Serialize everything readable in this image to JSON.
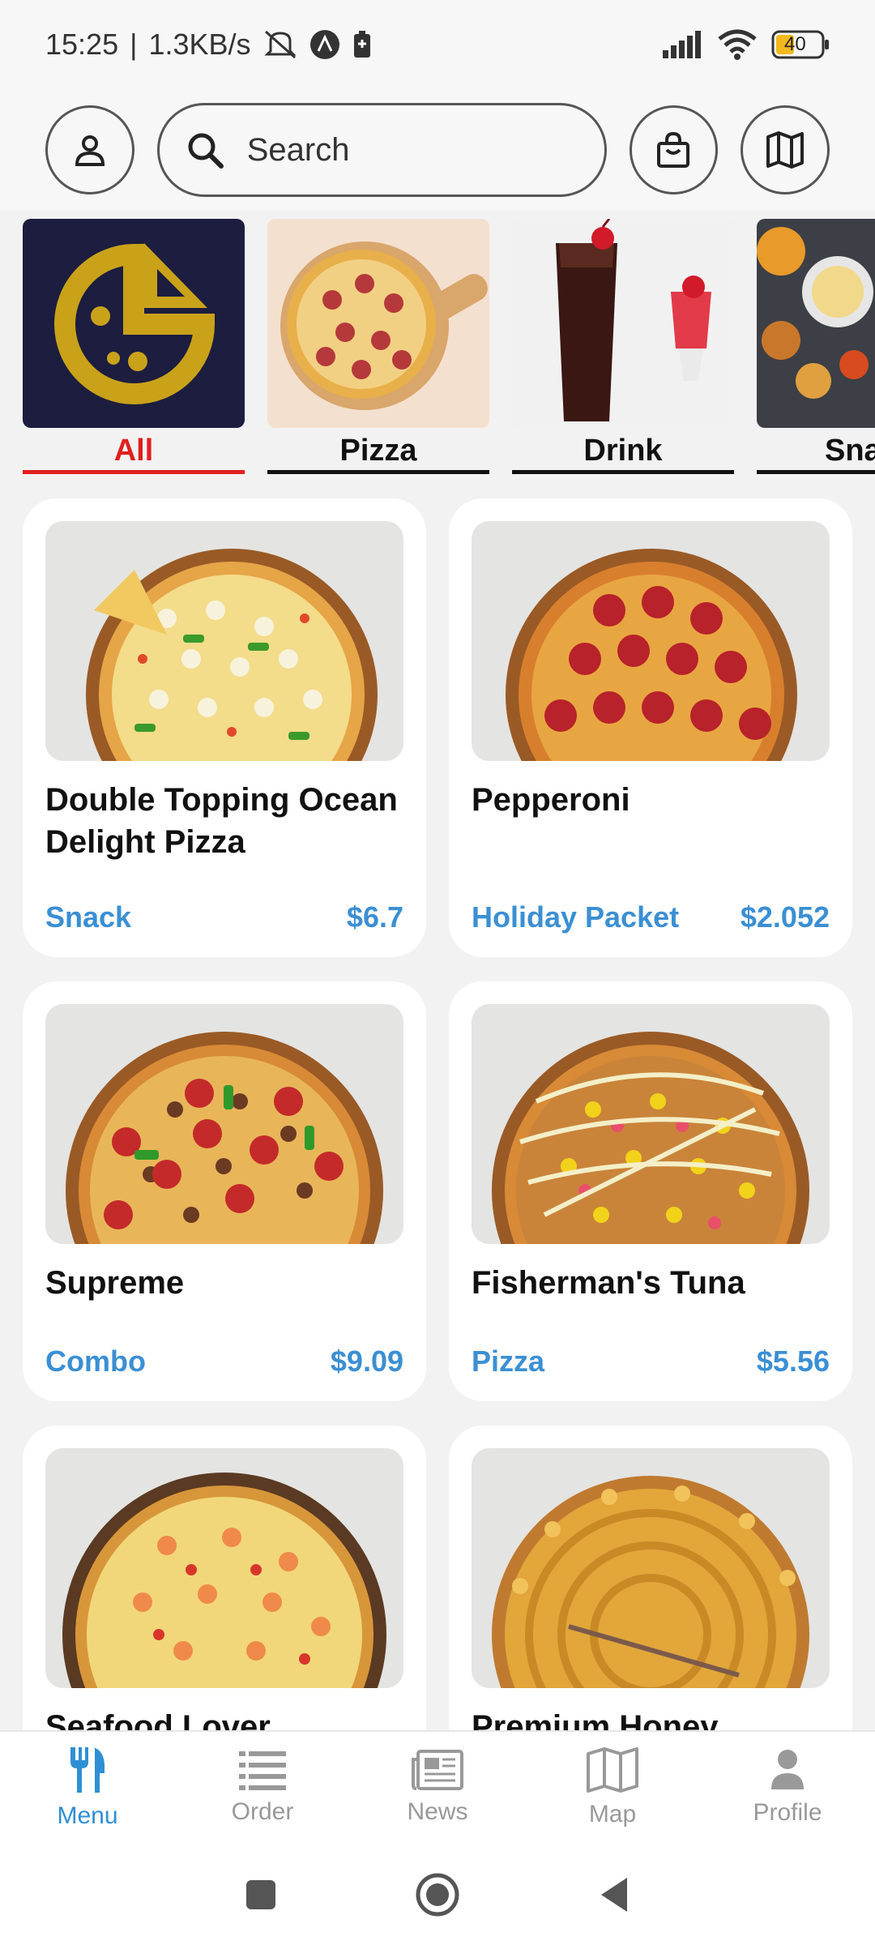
{
  "status_bar": {
    "time": "15:25",
    "network_speed": "1.3KB/s",
    "battery": "40",
    "icons": [
      "mute-icon",
      "app-a-icon",
      "battery-saver-icon",
      "signal-icon",
      "wifi-icon",
      "battery-icon"
    ]
  },
  "header": {
    "search_placeholder": "Search",
    "icons": [
      "user-icon",
      "search-icon",
      "shopping-bag-icon",
      "map-icon"
    ]
  },
  "categories": [
    {
      "label": "All",
      "active": true
    },
    {
      "label": "Pizza",
      "active": false
    },
    {
      "label": "Drink",
      "active": false
    },
    {
      "label": "Sna",
      "active": false
    }
  ],
  "products": [
    {
      "name": "Double Topping Ocean Delight Pizza",
      "category": "Snack",
      "price": "$6.7"
    },
    {
      "name": "Pepperoni",
      "category": "Holiday Packet",
      "price": "$2.052"
    },
    {
      "name": "Supreme",
      "category": "Combo",
      "price": "$9.09"
    },
    {
      "name": "Fisherman's Tuna",
      "category": "Pizza",
      "price": "$5.56"
    },
    {
      "name": "Seafood Lover",
      "category": "",
      "price": ""
    },
    {
      "name": "Premium Honey",
      "category": "",
      "price": ""
    }
  ],
  "bottom_nav": [
    {
      "label": "Menu",
      "icon": "utensils-icon",
      "active": true
    },
    {
      "label": "Order",
      "icon": "list-icon",
      "active": false
    },
    {
      "label": "News",
      "icon": "newspaper-icon",
      "active": false
    },
    {
      "label": "Map",
      "icon": "map-icon",
      "active": false
    },
    {
      "label": "Profile",
      "icon": "person-icon",
      "active": false
    }
  ],
  "colors": {
    "accent_red": "#e0201d",
    "accent_blue": "#3b8fd4",
    "logo_navy": "#1c1d3f",
    "logo_gold": "#c9a21a"
  }
}
